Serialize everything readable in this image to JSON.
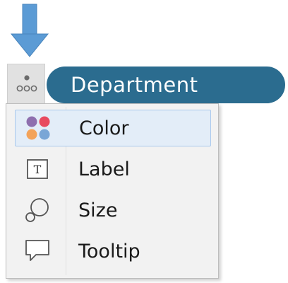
{
  "arrow": {
    "color": "#5b9bd5",
    "icon": "arrow-down-icon"
  },
  "detail_button": {
    "icon": "detail-dots-icon"
  },
  "pill": {
    "label": "Department",
    "color": "#2b6c8f"
  },
  "menu": {
    "items": [
      {
        "label": "Color",
        "icon": "color-icon",
        "highlighted": true
      },
      {
        "label": "Label",
        "icon": "label-icon"
      },
      {
        "label": "Size",
        "icon": "size-icon"
      },
      {
        "label": "Tooltip",
        "icon": "tooltip-icon"
      }
    ]
  },
  "colors": {
    "color_icon_purple": "#8e6fae",
    "color_icon_red": "#e84a5f",
    "color_icon_orange": "#f3a35a",
    "color_icon_blue": "#7aa6d6"
  }
}
